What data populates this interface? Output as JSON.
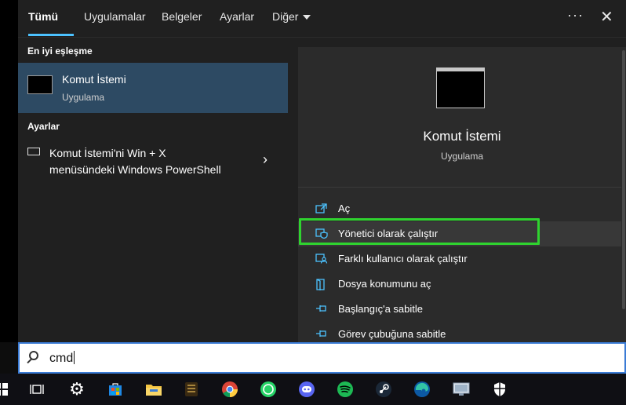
{
  "tabs": [
    {
      "label": "Tümü",
      "active": true
    },
    {
      "label": "Uygulamalar"
    },
    {
      "label": "Belgeler"
    },
    {
      "label": "Ayarlar"
    },
    {
      "label": "Diğer"
    }
  ],
  "more_glyph": "···",
  "close_glyph": "✕",
  "left": {
    "best_match_header": "En iyi eşleşme",
    "best_match": {
      "title": "Komut İstemi",
      "subtitle": "Uygulama"
    },
    "settings_header": "Ayarlar",
    "setting_item": {
      "line1": "Komut İstemi'ni Win + X",
      "line2": "menüsündeki Windows PowerShell"
    }
  },
  "right": {
    "title": "Komut İstemi",
    "subtitle": "Uygulama",
    "actions": [
      {
        "label": "Aç",
        "icon": "open-icon"
      },
      {
        "label": "Yönetici olarak çalıştır",
        "icon": "shield-icon"
      },
      {
        "label": "Farklı kullanıcı olarak çalıştır",
        "icon": "user-icon"
      },
      {
        "label": "Dosya konumunu aç",
        "icon": "folder-icon"
      },
      {
        "label": "Başlangıç'a sabitle",
        "icon": "pin-icon"
      },
      {
        "label": "Görev çubuğuna sabitle",
        "icon": "pin-icon"
      }
    ]
  },
  "search": {
    "value": "cmd"
  },
  "colors": {
    "accent": "#4cc2ff",
    "highlight_box": "#2fd32f",
    "selected_bg": "#2d4a63"
  },
  "taskbar_icons": [
    "start-icon",
    "task-view-icon",
    "settings-icon",
    "store-icon",
    "file-explorer-icon",
    "app-icon",
    "chrome-icon",
    "whatsapp-icon",
    "discord-icon",
    "spotify-icon",
    "steam-icon",
    "edge-icon",
    "monitor-app-icon",
    "security-icon"
  ]
}
